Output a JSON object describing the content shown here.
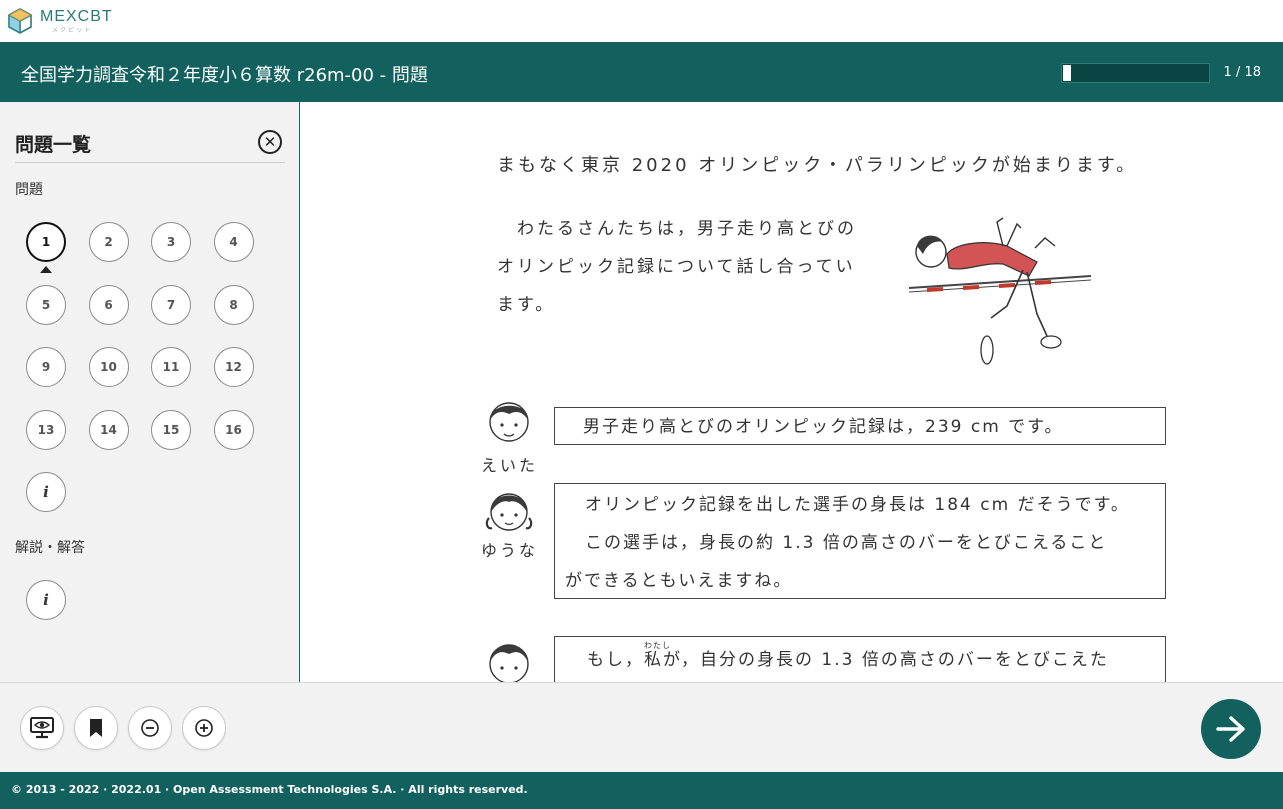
{
  "brand": {
    "name": "MEXCBT",
    "sub": "メクビット",
    "color": "#2a7a78"
  },
  "header": {
    "title": "全国学力調査令和２年度小６算数 r26m-00 - 問題",
    "counter": "1 / 18",
    "progress": 0.0556,
    "bar_color": "#12615f"
  },
  "sidebar": {
    "title": "問題一覧",
    "close_icon": "close-circle-icon",
    "questions_label": "問題",
    "questions": [
      "1",
      "2",
      "3",
      "4",
      "5",
      "6",
      "7",
      "8",
      "9",
      "10",
      "11",
      "12",
      "13",
      "14",
      "15",
      "16"
    ],
    "active_question": "1",
    "info_glyph": "i",
    "explanation_label": "解説・解答"
  },
  "content": {
    "intro": "まもなく東京 2020 オリンピック・パラリンピックが始まります。",
    "para_lines": [
      "わたるさんたちは，男子走り高とびの",
      "オリンピック記録について話し合ってい",
      "ます。"
    ],
    "dialogues": [
      {
        "name": "えいた",
        "lines": [
          "男子走り高とびのオリンピック記録は，239 cm です。"
        ]
      },
      {
        "name": "ゆうな",
        "lines": [
          "オリンピック記録を出した選手の身長は 184 cm だそうです。",
          "この選手は，身長の約 1.3 倍の高さのバーをとびこえること",
          "ができるともいえますね。"
        ]
      },
      {
        "name": "",
        "pre": "もし，",
        "ruby_base": "私",
        "ruby_text": "わたし",
        "post": "が，自分の身長の 1.3 倍の高さのバーをとびこえた"
      }
    ]
  },
  "toolbar": {
    "icons": [
      "screen-eye-icon",
      "bookmark-icon",
      "zoom-out-icon",
      "zoom-in-icon"
    ],
    "next_icon": "arrow-right-icon"
  },
  "footer": {
    "copyright": "© 2013 - 2022 · 2022.01 · Open Assessment Technologies S.A. · All rights reserved."
  }
}
